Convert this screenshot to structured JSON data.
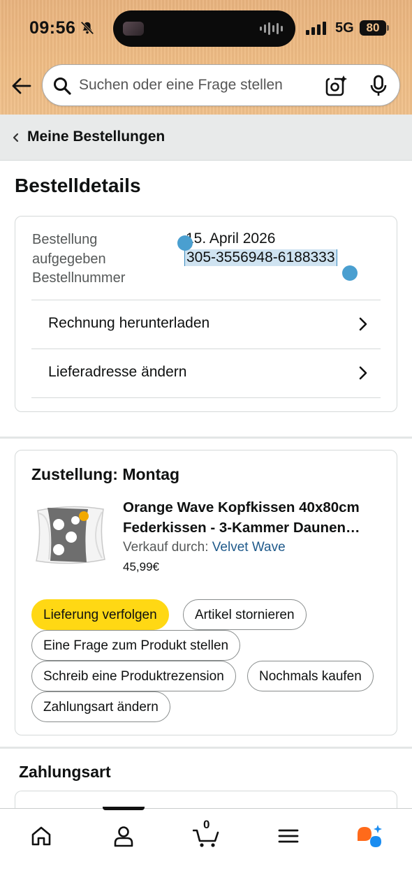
{
  "status_bar": {
    "time": "09:56",
    "network": "5G",
    "battery": "80",
    "icons": [
      "bell-off-icon",
      "signal-icon",
      "battery-icon"
    ]
  },
  "header": {
    "back_icon": "arrow-left-icon",
    "search_placeholder": "Suchen oder eine Frage stellen",
    "icons": [
      "search-icon",
      "camera-sparkle-icon",
      "microphone-icon"
    ]
  },
  "breadcrumb": {
    "label": "Meine Bestellungen"
  },
  "page_title": "Bestelldetails",
  "order": {
    "label_placed_line1": "Bestellung",
    "label_placed_line2": "aufgegeben",
    "label_number": "Bestellnummer",
    "date": "15. April 2026",
    "number": "305-3556948-6188333",
    "links": [
      {
        "label": "Rechnung herunterladen"
      },
      {
        "label": "Lieferadresse ändern"
      }
    ]
  },
  "delivery": {
    "title": "Zustellung: Montag",
    "product": {
      "title_line1": "Orange Wave Kopfkissen 40x80cm",
      "title_line2": "Federkissen - 3-Kammer Daunen…",
      "seller_prefix": "Verkauf durch: ",
      "seller_name": "Velvet Wave",
      "price": "45,99€"
    },
    "actions": {
      "track": "Lieferung verfolgen",
      "cancel": "Artikel stornieren",
      "question": "Eine Frage zum Produkt stellen",
      "review": "Schreib eine Produktrezension",
      "buy_again": "Nochmals kaufen",
      "change_payment": "Zahlungsart ändern"
    }
  },
  "payment": {
    "title": "Zahlungsart"
  },
  "bottom_nav": {
    "cart_count": "0",
    "items": [
      "home-icon",
      "account-icon",
      "cart-icon",
      "menu-icon",
      "rufus-ai-icon"
    ]
  },
  "colors": {
    "header_bg": "#efbd85",
    "primary_button": "#ffd814",
    "link": "#1f5a8b",
    "selection": "#cfe3f1",
    "selection_handle": "#4a9fd0"
  }
}
